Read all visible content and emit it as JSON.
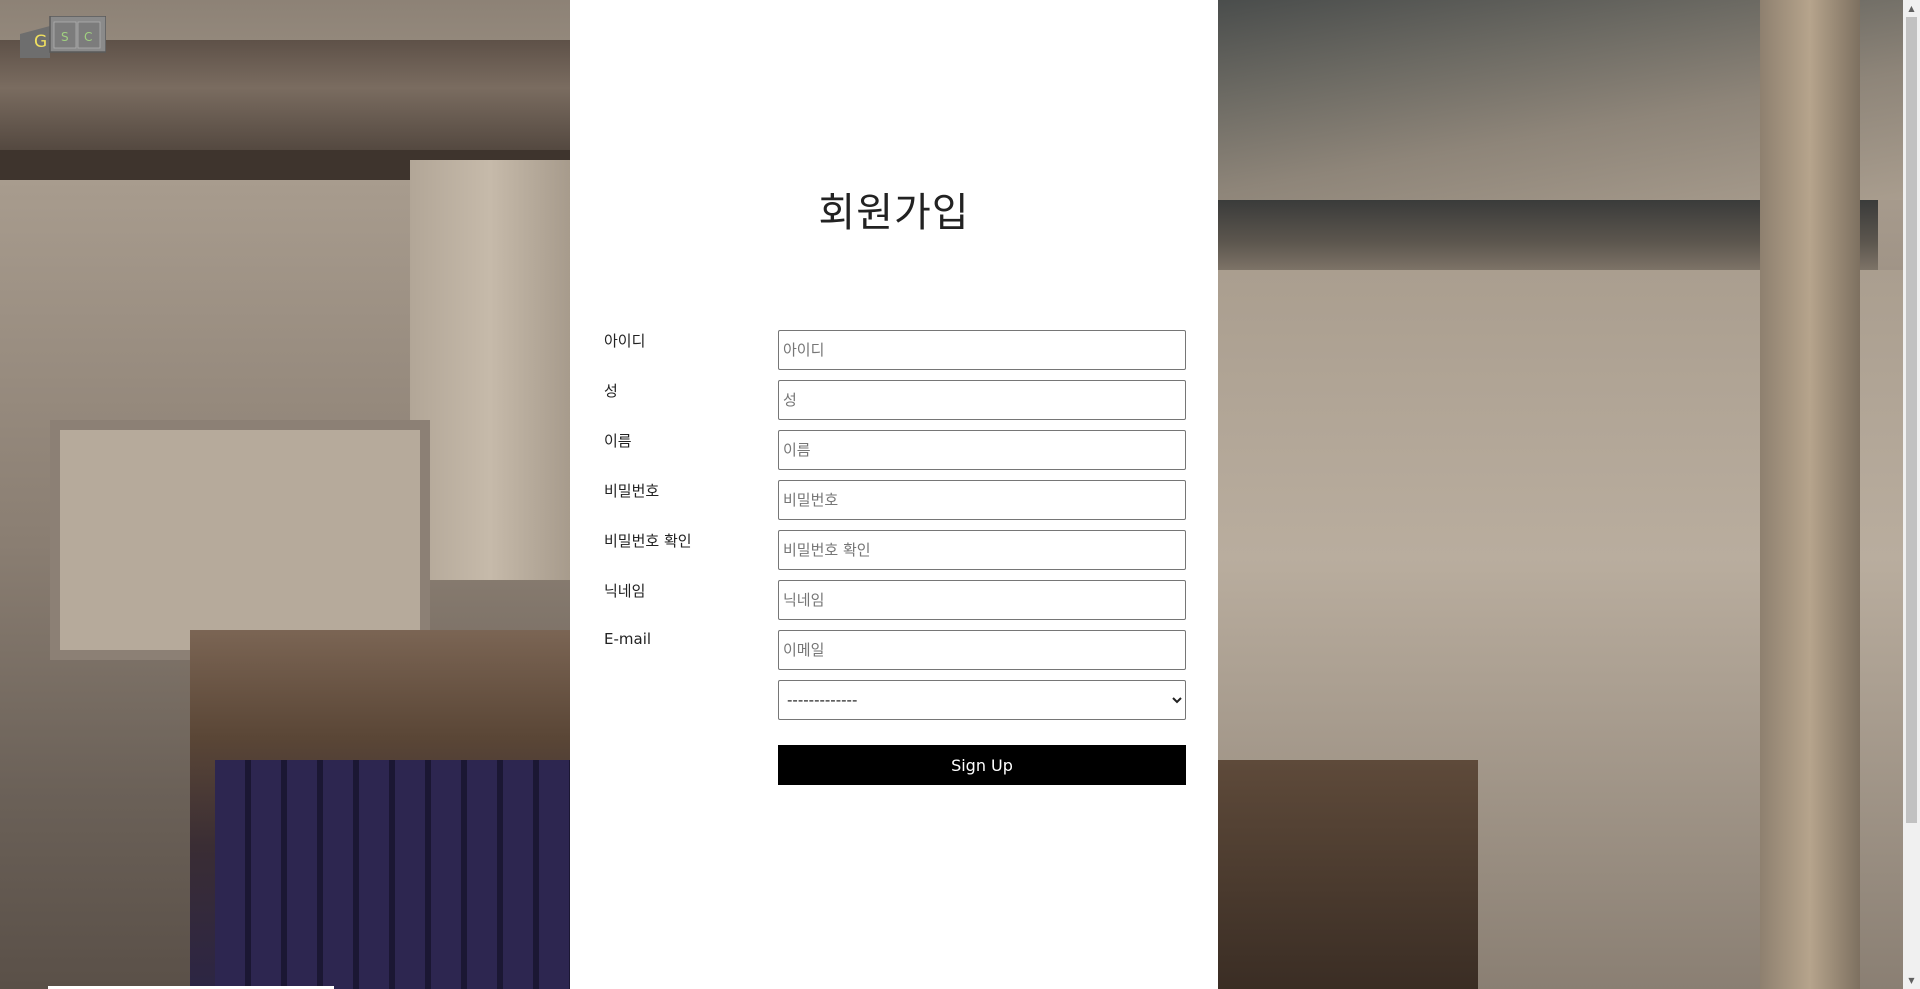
{
  "logo": {
    "letters": [
      "G",
      "S",
      "C"
    ]
  },
  "page": {
    "title": "회원가입"
  },
  "form": {
    "fields": [
      {
        "label": "아이디",
        "placeholder": "아이디"
      },
      {
        "label": "성",
        "placeholder": "성"
      },
      {
        "label": "이름",
        "placeholder": "이름"
      },
      {
        "label": "비밀번호",
        "placeholder": "비밀번호"
      },
      {
        "label": "비밀번호 확인",
        "placeholder": "비밀번호 확인"
      },
      {
        "label": "닉네임",
        "placeholder": "닉네임"
      },
      {
        "label": "E-mail",
        "placeholder": "이메일"
      }
    ],
    "select": {
      "selected": "-------------"
    },
    "submit_label": "Sign Up"
  },
  "colors": {
    "panel_background": "#ffffff",
    "button_background": "#000000",
    "button_text": "#ffffff",
    "logo_fill": "#7a7a7a",
    "logo_letter_g": "#f0e060",
    "logo_letter_sc": "#a0d080"
  }
}
